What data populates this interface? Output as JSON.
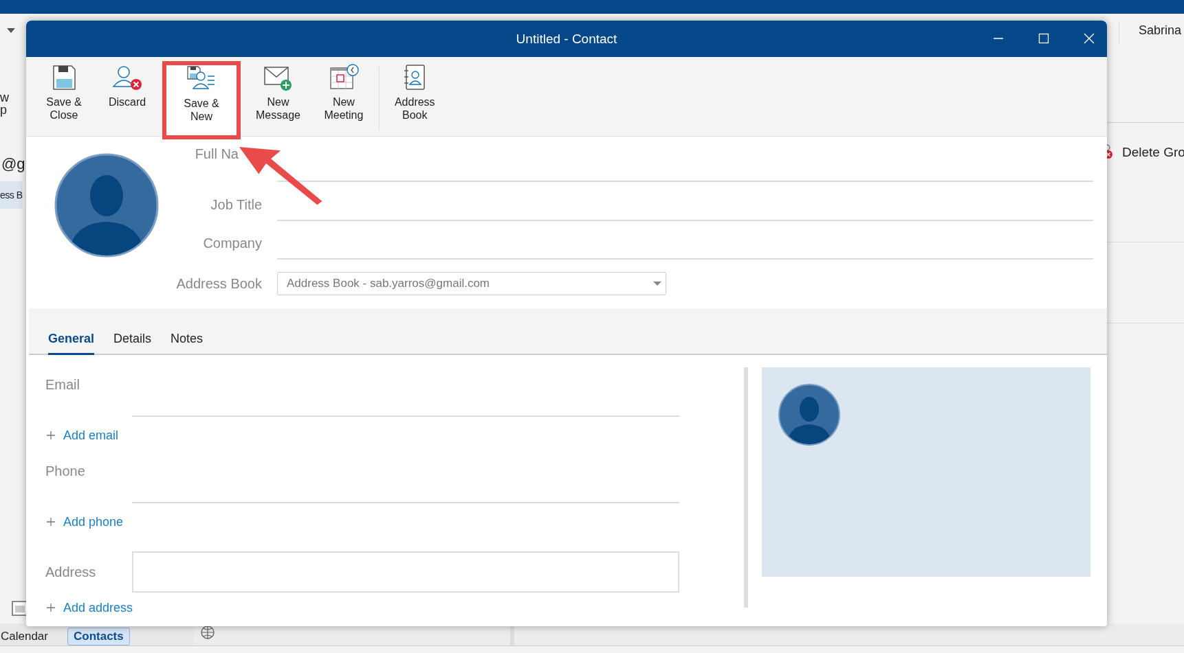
{
  "app": {
    "account": "Sabrina",
    "left_fragments": [
      "w",
      "p",
      "@g",
      "ess B"
    ],
    "right_action": "Delete Gro",
    "nav": [
      {
        "label": "Calendar",
        "selected": false
      },
      {
        "label": "Contacts",
        "selected": true
      }
    ]
  },
  "dialog": {
    "title": "Untitled - Contact",
    "ribbon": [
      {
        "kind": "save-close",
        "lines": [
          "Save &",
          "Close"
        ],
        "highlighted": false
      },
      {
        "kind": "discard",
        "lines": [
          "Discard"
        ],
        "highlighted": false
      },
      {
        "kind": "save-new",
        "lines": [
          "Save &",
          "New"
        ],
        "highlighted": true
      },
      {
        "kind": "message",
        "lines": [
          "New",
          "Message"
        ],
        "highlighted": false
      },
      {
        "kind": "meeting",
        "lines": [
          "New",
          "Meeting"
        ],
        "highlighted": false
      },
      {
        "kind": "address-book",
        "lines": [
          "Address",
          "Book"
        ],
        "highlighted": false
      }
    ],
    "fields": [
      {
        "label": "Full Na"
      },
      {
        "label": "Job Title"
      },
      {
        "label": "Company"
      }
    ],
    "address_book": {
      "label": "Address Book",
      "value": "Address Book - sab.yarros@gmail.com"
    },
    "tabs": [
      {
        "label": "General",
        "selected": true
      },
      {
        "label": "Details",
        "selected": false
      },
      {
        "label": "Notes",
        "selected": false
      }
    ],
    "sections": [
      {
        "kind": "line",
        "label": "Email",
        "add": "Add email"
      },
      {
        "kind": "line",
        "label": "Phone",
        "add": "Add phone"
      },
      {
        "kind": "box",
        "label": "Address",
        "add": "Add address"
      }
    ]
  }
}
